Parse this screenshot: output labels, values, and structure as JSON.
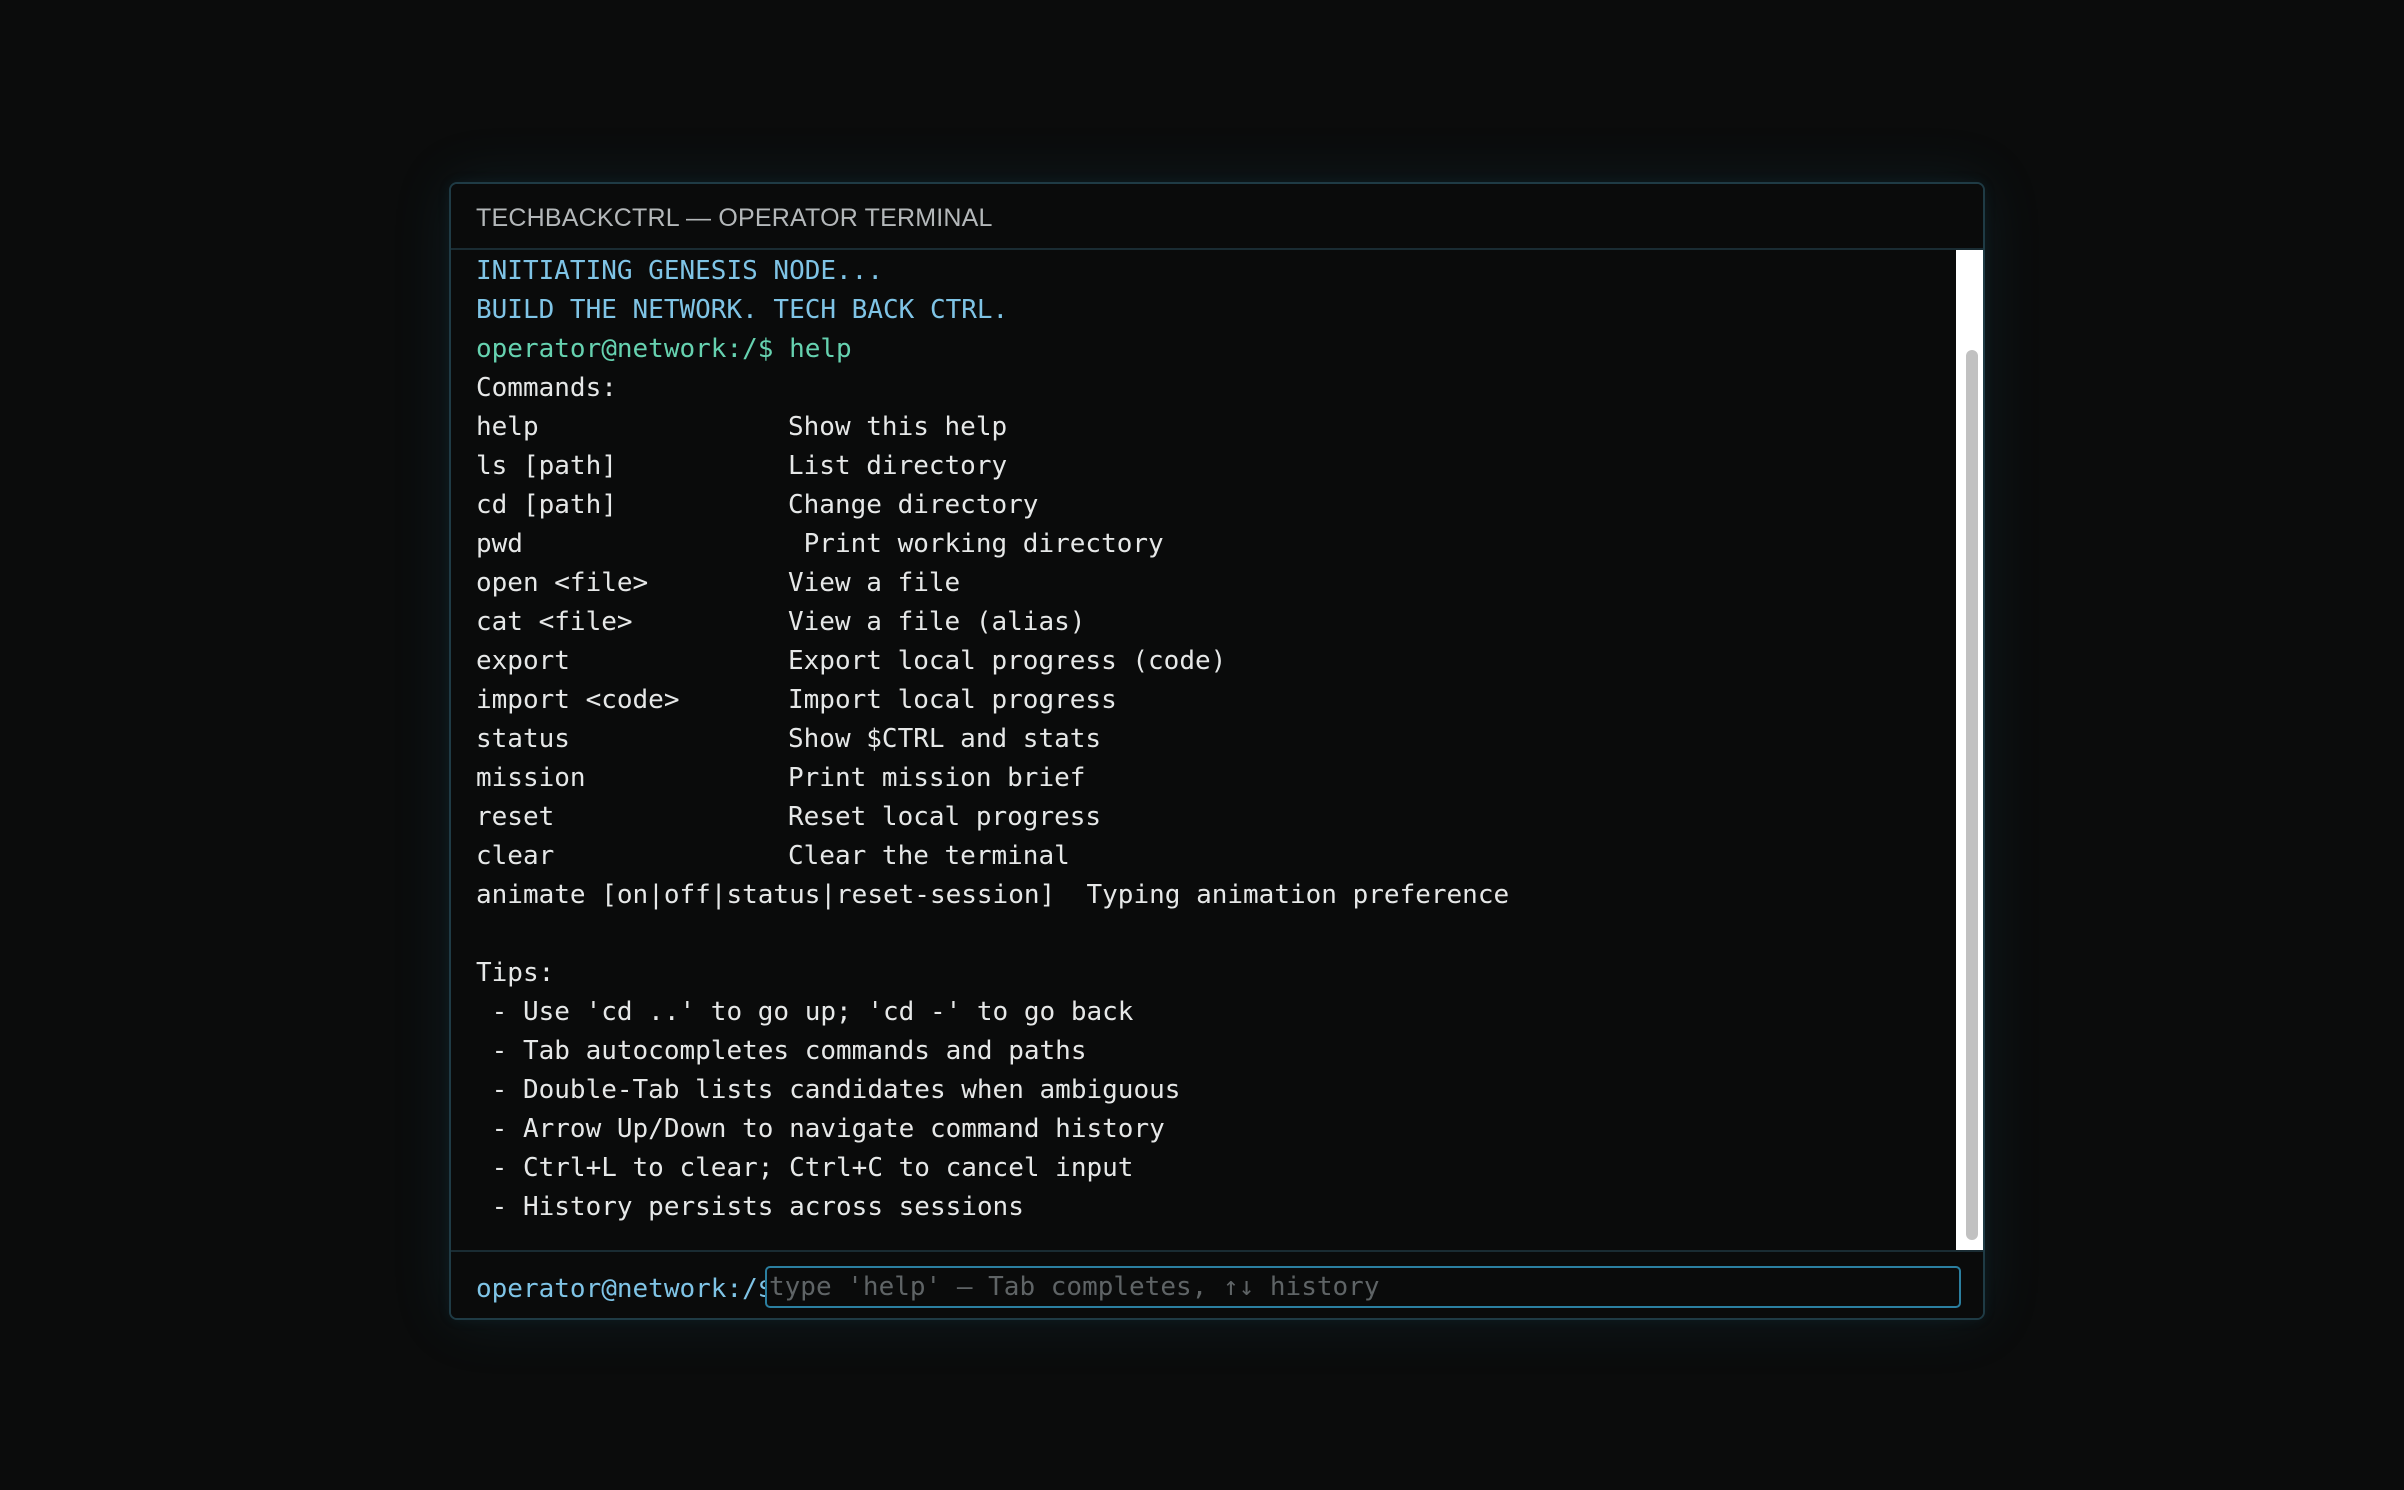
{
  "window": {
    "title": "TECHBACKCTRL — OPERATOR TERMINAL"
  },
  "boot": {
    "line1": "INITIATING GENESIS NODE...",
    "line2": "BUILD THE NETWORK. TECH BACK CTRL."
  },
  "history": {
    "prompt": "operator@network:/$ ",
    "command": "help"
  },
  "help": {
    "commands_heading": "Commands:",
    "commands": [
      {
        "name": "help",
        "desc": "Show this help"
      },
      {
        "name": "ls [path]",
        "desc": "List directory"
      },
      {
        "name": "cd [path]",
        "desc": "Change directory"
      },
      {
        "name": "pwd",
        "desc": " Print working directory"
      },
      {
        "name": "open <file>",
        "desc": "View a file"
      },
      {
        "name": "cat <file>",
        "desc": "View a file (alias)"
      },
      {
        "name": "export",
        "desc": "Export local progress (code)"
      },
      {
        "name": "import <code>",
        "desc": "Import local progress"
      },
      {
        "name": "status",
        "desc": "Show $CTRL and stats"
      },
      {
        "name": "mission",
        "desc": "Print mission brief"
      },
      {
        "name": "reset",
        "desc": "Reset local progress"
      },
      {
        "name": "clear",
        "desc": "Clear the terminal"
      }
    ],
    "animate": {
      "name": "animate [on|off|status|reset-session]",
      "desc": "Typing animation preference"
    },
    "tips_heading": "Tips:",
    "tips": [
      " - Use 'cd ..' to go up; 'cd -' to go back",
      " - Tab autocompletes commands and paths",
      " - Double-Tab lists candidates when ambiguous",
      " - Arrow Up/Down to navigate command history",
      " - Ctrl+L to clear; Ctrl+C to cancel input",
      " - History persists across sessions"
    ]
  },
  "input": {
    "prompt": "operator@network:/$",
    "value": "",
    "placeholder": "type 'help' — Tab completes, ↑↓ history"
  },
  "colors": {
    "background": "#0b0c0c",
    "system_text": "#7fc4e6",
    "prompt_text": "#66d2b0",
    "output_text": "#e6e8e8",
    "input_border": "#2b7fa0"
  }
}
